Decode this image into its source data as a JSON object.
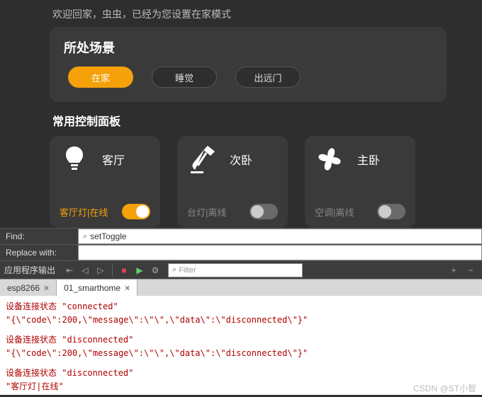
{
  "welcome": "欢迎回家，虫虫，已经为您设置在家模式",
  "scene": {
    "title": "所处场景",
    "buttons": [
      "在家",
      "睡觉",
      "出远门"
    ],
    "active": 0
  },
  "panel_title": "常用控制面板",
  "cards": [
    {
      "room": "客厅",
      "status": "客厅灯|在线",
      "online": true,
      "on": true
    },
    {
      "room": "次卧",
      "status": "台灯|离线",
      "online": false,
      "on": false
    },
    {
      "room": "主卧",
      "status": "空调|离线",
      "online": false,
      "on": false
    }
  ],
  "find": {
    "label": "Find:",
    "value": "setToggle",
    "icon": "⌕"
  },
  "replace": {
    "label": "Replace with:"
  },
  "toolbar": {
    "label": "应用程序输出",
    "filter_placeholder": "Filter"
  },
  "tabs": [
    {
      "label": "esp8266",
      "active": false
    },
    {
      "label": "01_smarthome",
      "active": true
    }
  ],
  "console": [
    [
      "设备连接状态 \"connected\"",
      "\"{\\\"code\\\":200,\\\"message\\\":\\\"\\\",\\\"data\\\":\\\"disconnected\\\"}\""
    ],
    [
      "设备连接状态 \"disconnected\"",
      "\"{\\\"code\\\":200,\\\"message\\\":\\\"\\\",\\\"data\\\":\\\"disconnected\\\"}\""
    ],
    [
      "设备连接状态 \"disconnected\"",
      "\"客厅灯|在线\""
    ]
  ],
  "watermark": "CSDN @ST小智"
}
